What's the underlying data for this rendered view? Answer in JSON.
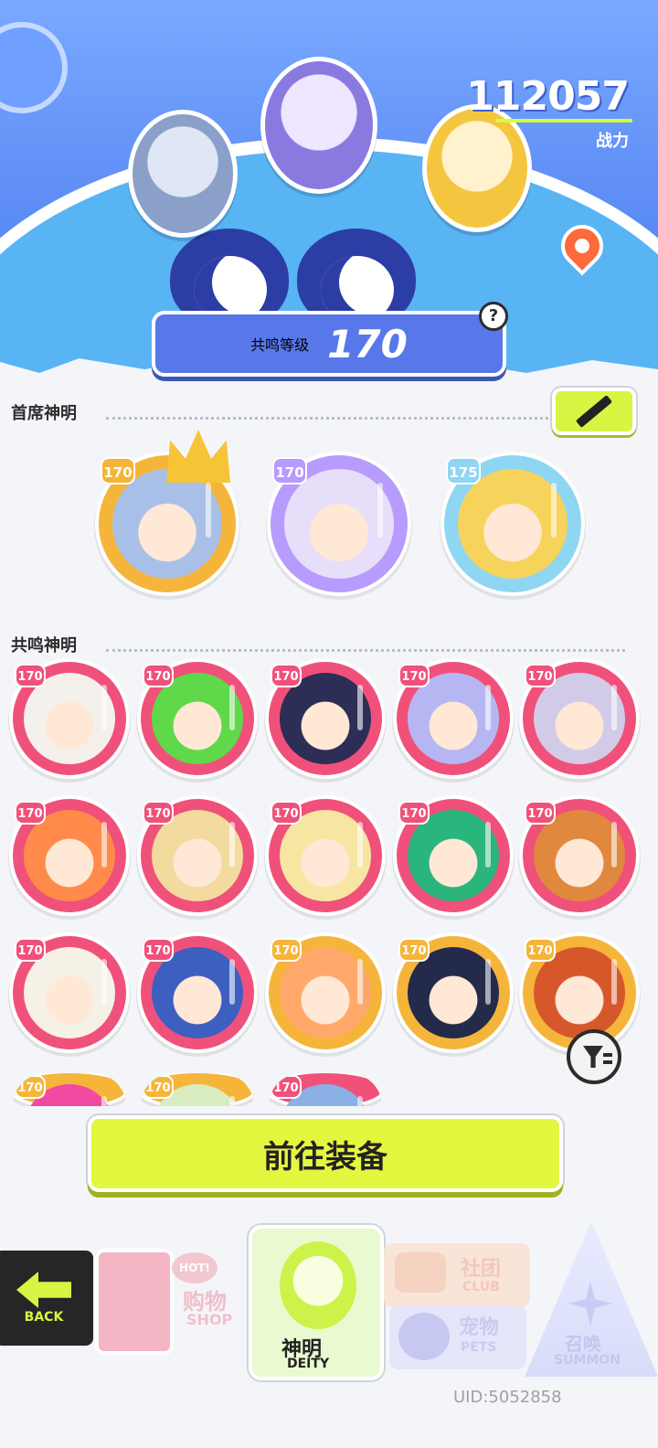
{
  "header": {
    "power_value": "112057",
    "power_label": "战力",
    "resonance_label": "共鸣等级",
    "resonance_level": "170",
    "help_symbol": "?"
  },
  "sections": {
    "leaders_title": "首席神明",
    "resonance_title": "共鸣神明"
  },
  "leaders": [
    {
      "level": "170",
      "frame_color": "#f5b53a",
      "hair_color": "#a8c0e8",
      "crowned": true
    },
    {
      "level": "170",
      "frame_color": "#b79bff",
      "hair_color": "#e7defa",
      "crowned": false
    },
    {
      "level": "175",
      "frame_color": "#8fd6f2",
      "hair_color": "#f6d35a",
      "crowned": false
    }
  ],
  "resonance_deities": [
    {
      "level": "170",
      "frame_color": "#f0517a",
      "hair_color": "#f4f1ec"
    },
    {
      "level": "170",
      "frame_color": "#f0517a",
      "hair_color": "#5fd84a"
    },
    {
      "level": "170",
      "frame_color": "#f0517a",
      "hair_color": "#2c2e55"
    },
    {
      "level": "170",
      "frame_color": "#f0517a",
      "hair_color": "#b6b7f2"
    },
    {
      "level": "170",
      "frame_color": "#f0517a",
      "hair_color": "#d2cbe8"
    },
    {
      "level": "170",
      "frame_color": "#f0517a",
      "hair_color": "#ff8a4a"
    },
    {
      "level": "170",
      "frame_color": "#f0517a",
      "hair_color": "#f3dba0"
    },
    {
      "level": "170",
      "frame_color": "#f0517a",
      "hair_color": "#f6e6a2"
    },
    {
      "level": "170",
      "frame_color": "#f0517a",
      "hair_color": "#2ab57c"
    },
    {
      "level": "170",
      "frame_color": "#f0517a",
      "hair_color": "#e0883e"
    },
    {
      "level": "170",
      "frame_color": "#f0517a",
      "hair_color": "#f5f1e7"
    },
    {
      "level": "170",
      "frame_color": "#f0517a",
      "hair_color": "#3d5fc0"
    },
    {
      "level": "170",
      "frame_color": "#f5b53a",
      "hair_color": "#ffa86a"
    },
    {
      "level": "170",
      "frame_color": "#f5b53a",
      "hair_color": "#242a4a"
    },
    {
      "level": "170",
      "frame_color": "#f5b53a",
      "hair_color": "#d6582a"
    },
    {
      "level": "170",
      "frame_color": "#f5b53a",
      "hair_color": "#f24aa0"
    },
    {
      "level": "170",
      "frame_color": "#f5b53a",
      "hair_color": "#d8ecc0"
    },
    {
      "level": "170",
      "frame_color": "#f0517a",
      "hair_color": "#8ab0e6"
    }
  ],
  "equip_button_label": "前往装备",
  "nav": {
    "back_label": "BACK",
    "shop_hot": "HOT!",
    "shop_zh": "购物",
    "shop_en": "SHOP",
    "deity_zh": "神明",
    "deity_en": "DEITY",
    "club_zh": "社团",
    "club_en": "CLUB",
    "pets_zh": "宠物",
    "pets_en": "PETS",
    "summon_zh": "召唤",
    "summon_en": "SUMMON"
  },
  "uid": "UID:5052858",
  "colors": {
    "accent_lime": "#d7f542",
    "hero_blue": "#5c8cf5",
    "frame_pink": "#f0517a",
    "frame_gold": "#f5b53a"
  }
}
